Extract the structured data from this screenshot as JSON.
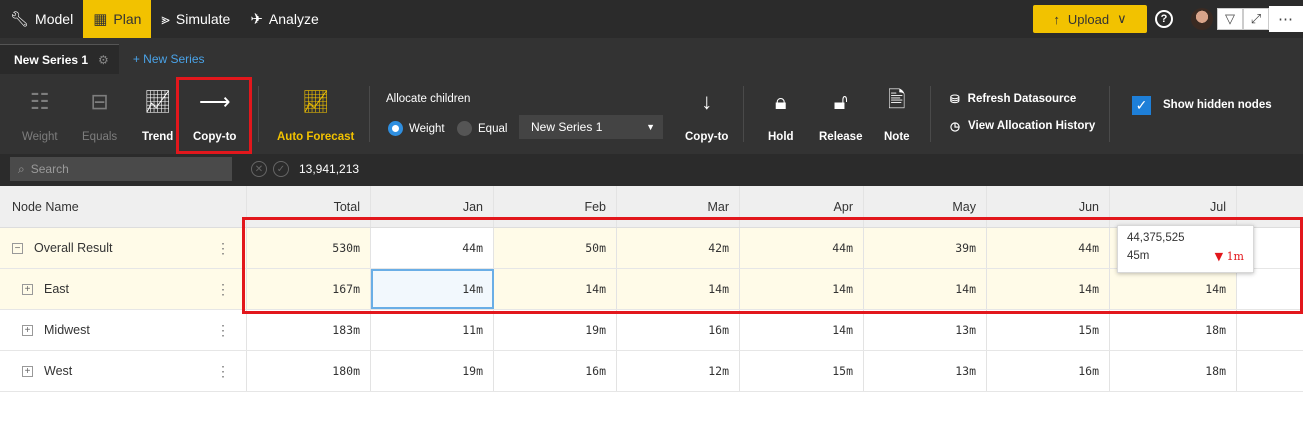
{
  "nav": {
    "tabs": [
      {
        "label": "Model",
        "icon": "wrench-icon"
      },
      {
        "label": "Plan",
        "icon": "table-icon",
        "active": true
      },
      {
        "label": "Simulate",
        "icon": "simulate-icon"
      },
      {
        "label": "Analyze",
        "icon": "telescope-icon"
      }
    ],
    "upload_label": "Upload",
    "help_label": "?",
    "accent": "#f2c200"
  },
  "series": {
    "active": "New Series 1",
    "new_label": "+ New Series"
  },
  "ribbon": {
    "weight": "Weight",
    "equals": "Equals",
    "trend": "Trend",
    "copy_to": "Copy-to",
    "auto_forecast": "Auto Forecast",
    "allocate_title": "Allocate children",
    "radio_weight": "Weight",
    "radio_equal": "Equal",
    "series_select": "New Series 1",
    "copy_to_2": "Copy-to",
    "hold": "Hold",
    "release": "Release",
    "note": "Note",
    "refresh": "Refresh Datasource",
    "history": "View Allocation History",
    "show_hidden": "Show hidden nodes"
  },
  "search": {
    "placeholder": "Search",
    "total": "13,941,213"
  },
  "table": {
    "node_header": "Node Name",
    "columns": [
      "Total",
      "Jan",
      "Feb",
      "Mar",
      "Apr",
      "May",
      "Jun",
      "Jul"
    ],
    "rows": [
      {
        "name": "Overall Result",
        "expand": "−",
        "values": [
          "530m",
          "44m",
          "50m",
          "42m",
          "44m",
          "39m",
          "44m",
          ""
        ]
      },
      {
        "name": "East",
        "expand": "+",
        "values": [
          "167m",
          "14m",
          "14m",
          "14m",
          "14m",
          "14m",
          "14m",
          "14m"
        ]
      },
      {
        "name": "Midwest",
        "expand": "+",
        "values": [
          "183m",
          "11m",
          "19m",
          "16m",
          "14m",
          "13m",
          "15m",
          "18m"
        ]
      },
      {
        "name": "West",
        "expand": "+",
        "values": [
          "180m",
          "19m",
          "16m",
          "12m",
          "15m",
          "13m",
          "16m",
          "18m"
        ]
      }
    ]
  },
  "tooltip": {
    "value": "44,375,525",
    "short": "45m",
    "delta": "1m",
    "delta_color": "#e2171c"
  }
}
